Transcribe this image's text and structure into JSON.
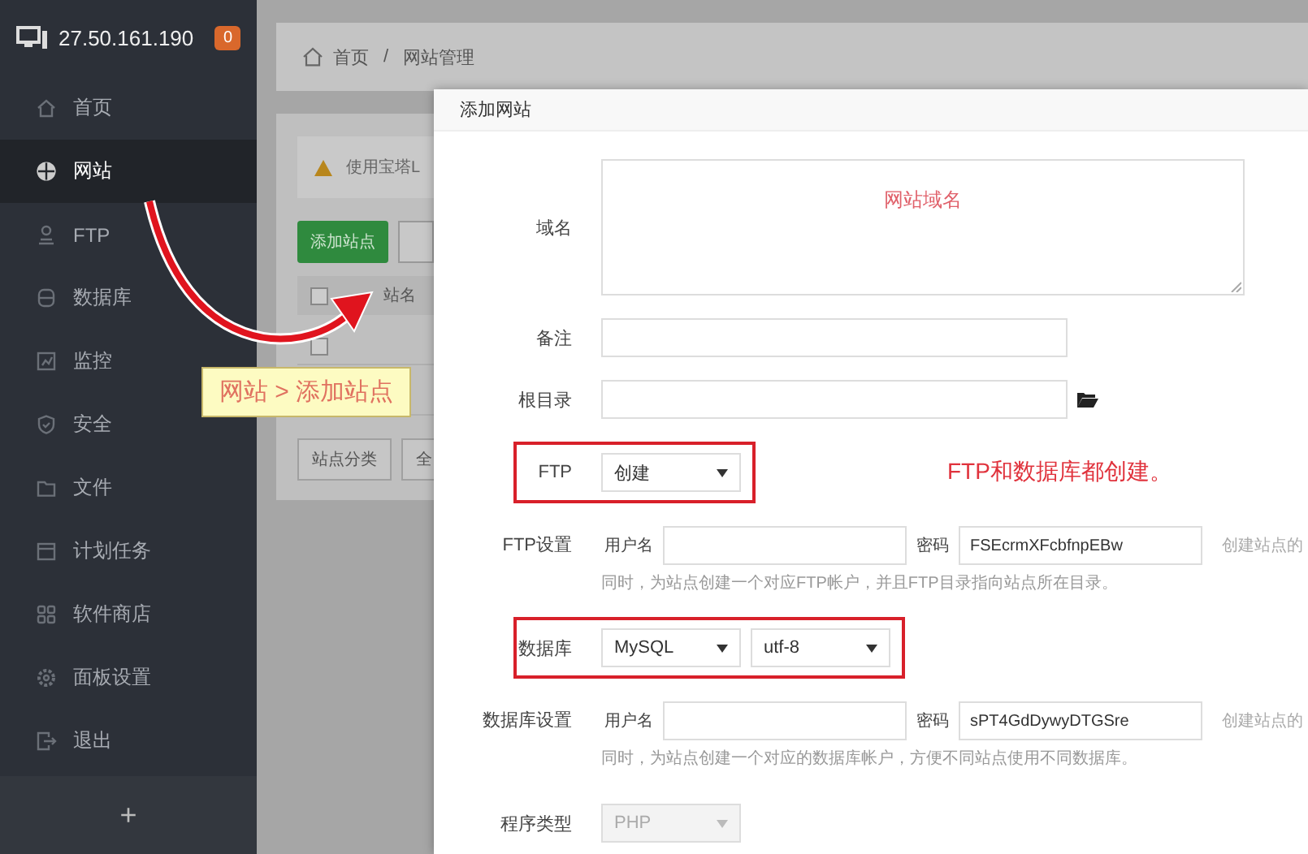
{
  "sidebar": {
    "host": "27.50.161.190",
    "badge": "0",
    "items": [
      {
        "label": "首页",
        "selected": false
      },
      {
        "label": "网站",
        "selected": true
      },
      {
        "label": "FTP",
        "selected": false
      },
      {
        "label": "数据库",
        "selected": false
      },
      {
        "label": "监控",
        "selected": false
      },
      {
        "label": "安全",
        "selected": false
      },
      {
        "label": "文件",
        "selected": false
      },
      {
        "label": "计划任务",
        "selected": false
      },
      {
        "label": "软件商店",
        "selected": false
      },
      {
        "label": "面板设置",
        "selected": false
      },
      {
        "label": "退出",
        "selected": false
      }
    ],
    "add_button": "+"
  },
  "breadcrumb": {
    "items": [
      "首页",
      "网站管理"
    ],
    "separator": "/"
  },
  "background": {
    "warning": "使用宝塔L",
    "add_button": "添加站点",
    "table_header": "站名",
    "header_checked": false,
    "rows": [
      {
        "checked": false
      }
    ],
    "category_button": "站点分类",
    "category_value": "全"
  },
  "dialog": {
    "title": "添加网站",
    "fields": [
      {
        "kind": "textarea",
        "label": "域名",
        "placeholder": "网站域名"
      },
      {
        "kind": "text",
        "label": "备注"
      },
      {
        "kind": "path",
        "label": "根目录"
      },
      {
        "kind": "select",
        "label": "FTP",
        "values": [
          "创建"
        ],
        "highlighted": true,
        "disabled": false
      },
      {
        "kind": "credentials",
        "label": "FTP设置",
        "user_label": "用户名",
        "password_label": "密码",
        "password": "FSEcrmXFcbfnpEBw",
        "trailing": "创建站点的",
        "hint": "同时，为站点创建一个对应FTP帐户，并且FTP目录指向站点所在目录。"
      },
      {
        "kind": "select",
        "label": "数据库",
        "values": [
          "MySQL",
          "utf-8"
        ],
        "highlighted": true,
        "disabled": false
      },
      {
        "kind": "credentials",
        "label": "数据库设置",
        "user_label": "用户名",
        "password_label": "密码",
        "password": "sPT4GdDywyDTGSre",
        "trailing": "创建站点的",
        "hint": "同时，为站点创建一个对应的数据库帐户，方便不同站点使用不同数据库。"
      },
      {
        "kind": "select",
        "label": "程序类型",
        "values": [
          "PHP"
        ],
        "highlighted": false,
        "disabled": true
      }
    ]
  },
  "annotations": {
    "callout": "网站 > 添加站点",
    "note": "FTP和数据库都创建。"
  }
}
